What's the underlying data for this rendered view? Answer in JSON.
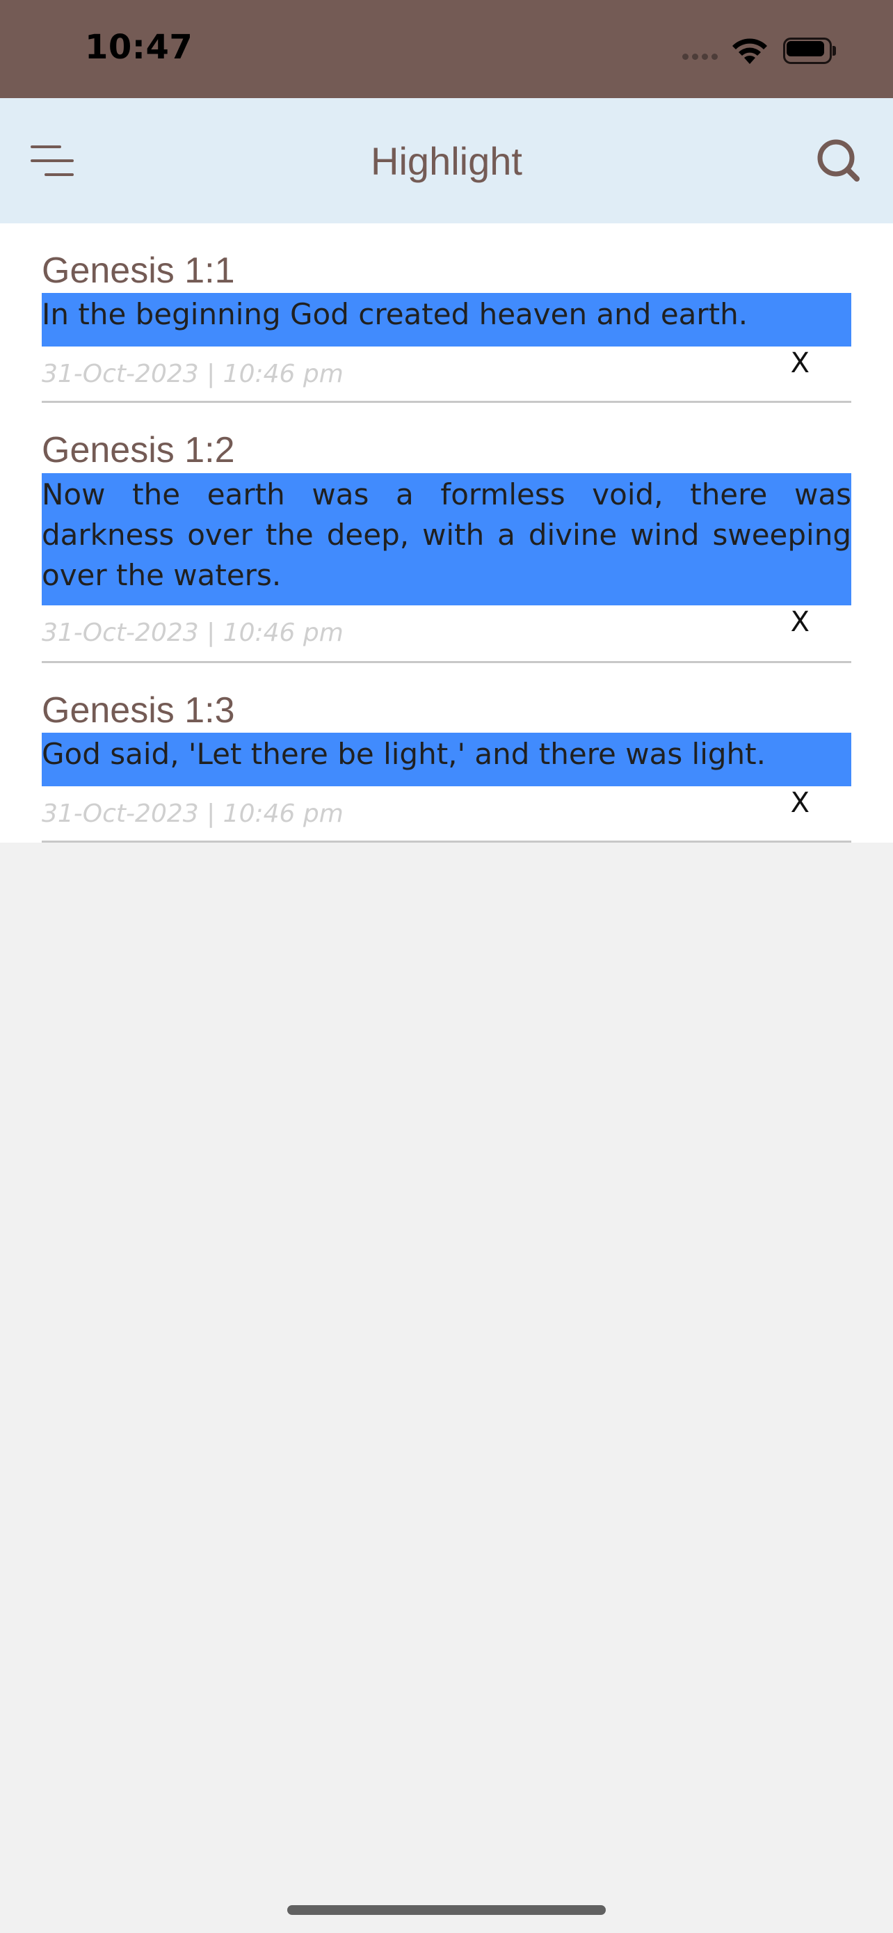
{
  "status_bar": {
    "time": "10:47",
    "icons": [
      "signal-dots-icon",
      "wifi-icon",
      "battery-icon"
    ]
  },
  "nav": {
    "title": "Highlight",
    "left_icon": "menu-icon",
    "right_icon": "search-icon"
  },
  "highlights": [
    {
      "reference": "Genesis 1:1",
      "text": "In the beginning God created heaven and earth.",
      "date": "31-Oct-2023 | 10:46 pm",
      "delete_label": "X"
    },
    {
      "reference": "Genesis 1:2",
      "text": "Now the earth was a formless void, there was darkness over the deep, with a divine wind sweeping over the waters.",
      "date": "31-Oct-2023 | 10:46 pm",
      "delete_label": "X"
    },
    {
      "reference": "Genesis 1:3",
      "text": "God said, 'Let there be light,' and there was light.",
      "date": "31-Oct-2023 | 10:46 pm",
      "delete_label": "X"
    }
  ],
  "colors": {
    "status_bar": "#745b55",
    "nav_bar": "#e0edf6",
    "highlight": "#418bfd",
    "accent_text": "#745b55",
    "background": "#f1f1f1"
  }
}
